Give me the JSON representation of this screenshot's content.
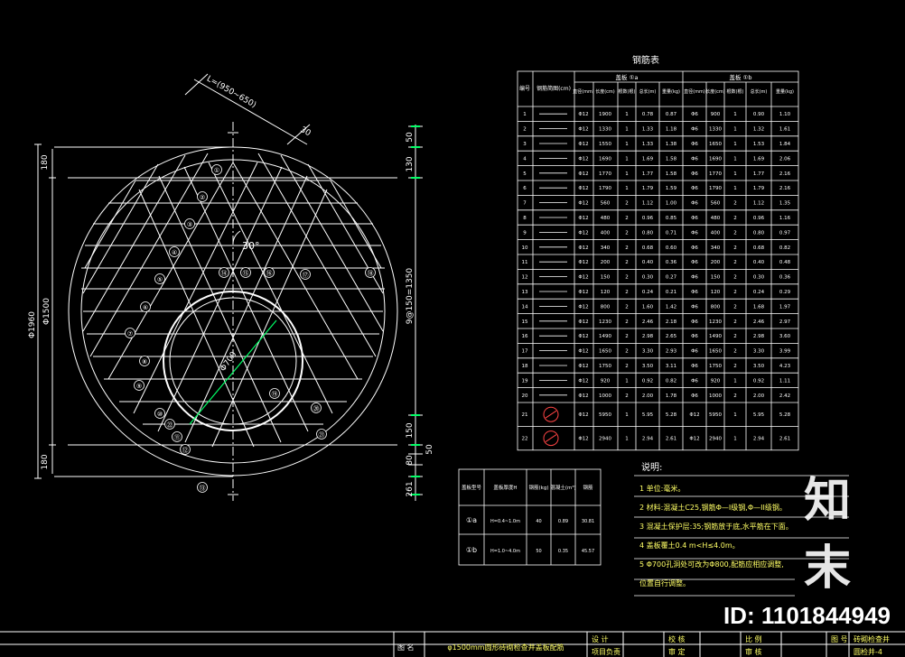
{
  "drawing": {
    "title": "φ1500mm圆形砖砌检查井盖板配筋",
    "table_title": "钢筋表",
    "cover_head_a": "盖板 ①a",
    "cover_head_b": "盖板 ①b",
    "col_no": "编号",
    "col_shape": "钢筋简图(cm)",
    "sub_cols": [
      "直径(mm)",
      "长度(cm)",
      "根数(根)",
      "总长(m)",
      "重量(kg)"
    ],
    "rows": [
      [
        "1",
        "Φ12",
        "1900",
        "1",
        "0.78",
        "0.87",
        "Φ6",
        "900",
        "1",
        "0.90",
        "1.10"
      ],
      [
        "2",
        "Φ12",
        "1330",
        "1",
        "1.33",
        "1.18",
        "Φ6",
        "1330",
        "1",
        "1.32",
        "1.61"
      ],
      [
        "3",
        "Φ12",
        "1550",
        "1",
        "1.33",
        "1.38",
        "Φ6",
        "1650",
        "1",
        "1.53",
        "1.84"
      ],
      [
        "4",
        "Φ12",
        "1690",
        "1",
        "1.69",
        "1.58",
        "Φ6",
        "1690",
        "1",
        "1.69",
        "2.06"
      ],
      [
        "5",
        "Φ12",
        "1770",
        "1",
        "1.77",
        "1.58",
        "Φ6",
        "1770",
        "1",
        "1.77",
        "2.16"
      ],
      [
        "6",
        "Φ12",
        "1790",
        "1",
        "1.79",
        "1.59",
        "Φ6",
        "1790",
        "1",
        "1.79",
        "2.16"
      ],
      [
        "7",
        "Φ12",
        "560",
        "2",
        "1.12",
        "1.00",
        "Φ6",
        "560",
        "2",
        "1.12",
        "1.35"
      ],
      [
        "8",
        "Φ12",
        "480",
        "2",
        "0.96",
        "0.85",
        "Φ6",
        "480",
        "2",
        "0.96",
        "1.16"
      ],
      [
        "9",
        "Φ12",
        "400",
        "2",
        "0.80",
        "0.71",
        "Φ6",
        "400",
        "2",
        "0.80",
        "0.97"
      ],
      [
        "10",
        "Φ12",
        "340",
        "2",
        "0.68",
        "0.60",
        "Φ6",
        "340",
        "2",
        "0.68",
        "0.82"
      ],
      [
        "11",
        "Φ12",
        "200",
        "2",
        "0.40",
        "0.36",
        "Φ6",
        "200",
        "2",
        "0.40",
        "0.48"
      ],
      [
        "12",
        "Φ12",
        "150",
        "2",
        "0.30",
        "0.27",
        "Φ6",
        "150",
        "2",
        "0.30",
        "0.36"
      ],
      [
        "13",
        "Φ12",
        "120",
        "2",
        "0.24",
        "0.21",
        "Φ6",
        "120",
        "2",
        "0.24",
        "0.29"
      ],
      [
        "14",
        "Φ12",
        "800",
        "2",
        "1.60",
        "1.42",
        "Φ6",
        "800",
        "2",
        "1.68",
        "1.97"
      ],
      [
        "15",
        "Φ12",
        "1230",
        "2",
        "2.46",
        "2.18",
        "Φ6",
        "1230",
        "2",
        "2.46",
        "2.97"
      ],
      [
        "16",
        "Φ12",
        "1490",
        "2",
        "2.98",
        "2.65",
        "Φ6",
        "1490",
        "2",
        "2.98",
        "3.60"
      ],
      [
        "17",
        "Φ12",
        "1650",
        "2",
        "3.30",
        "2.93",
        "Φ6",
        "1650",
        "2",
        "3.30",
        "3.99"
      ],
      [
        "18",
        "Φ12",
        "1750",
        "2",
        "3.50",
        "3.11",
        "Φ6",
        "1750",
        "2",
        "3.50",
        "4.23"
      ],
      [
        "19",
        "Φ12",
        "920",
        "1",
        "0.92",
        "0.82",
        "Φ6",
        "920",
        "1",
        "0.92",
        "1.11"
      ],
      [
        "20",
        "Φ12",
        "1000",
        "2",
        "2.00",
        "1.78",
        "Φ6",
        "1000",
        "2",
        "2.00",
        "2.42"
      ],
      [
        "21",
        "Φ12",
        "5950",
        "1",
        "5.95",
        "5.28",
        "Φ12",
        "5950",
        "1",
        "5.95",
        "5.28"
      ],
      [
        "22",
        "Φ12",
        "2940",
        "1",
        "2.94",
        "2.61",
        "Φ12",
        "2940",
        "1",
        "2.94",
        "2.61"
      ]
    ],
    "qty_headers": [
      "盖板型号",
      "盖板厚度H",
      "钢筋(kg)",
      "混凝土(m³)",
      "钢筋"
    ],
    "qty_rows": [
      [
        "①a",
        "H=0.4~1.0m",
        "40",
        "0.89",
        "30.81"
      ],
      [
        "①b",
        "H=1.0~4.0m",
        "50",
        "0.35",
        "45.57"
      ]
    ],
    "notes_title": "说明:",
    "notes": [
      "1  单位:毫米。",
      "2  材料:混凝土C25,钢筋Φ—I级钢,Φ—II级钢。",
      "3  混凝土保护层:35;钢筋放于底,水平筋在下面。",
      "4  盖板覆土0.4 m<H≤4.0m。",
      "5  Φ700孔洞处可改为Φ800,配筋应相应调整,",
      "   位置自行调整。"
    ],
    "dims": {
      "d_outer": "Φ1960",
      "d_inner": "Φ1500",
      "d_hole": "Φ700",
      "angle": "30°",
      "spacing": "9@150=1350",
      "slope_dim": "L=(950~650)",
      "d_180_top": "180",
      "d_180_bot": "180",
      "d50_top": "50",
      "d130": "130",
      "d150": "150",
      "d50_bot": "50",
      "d80": "80",
      "d261": "261",
      "d30": "30"
    },
    "rebar_labels": [
      "①",
      "②",
      "③",
      "④",
      "⑤",
      "⑥",
      "⑦",
      "⑧",
      "⑨",
      "⑩",
      "⑪",
      "⑫",
      "⑬",
      "⑭",
      "⑮",
      "⑯",
      "⑰",
      "⑱",
      "⑲",
      "⑳",
      "㉑",
      "㉒"
    ],
    "title_block": {
      "label_title": "图 名",
      "designer": "设 计",
      "checker": "校 核",
      "reviewer": "审 核",
      "project": "项目负责",
      "approve": "审 定",
      "scale": "比 例",
      "drawing_no_label": "图 号",
      "drawing_no": "圆检井-4",
      "unit_label": "砖砌检查井"
    },
    "watermark": "知末",
    "id_text": "ID: 1101844949"
  }
}
